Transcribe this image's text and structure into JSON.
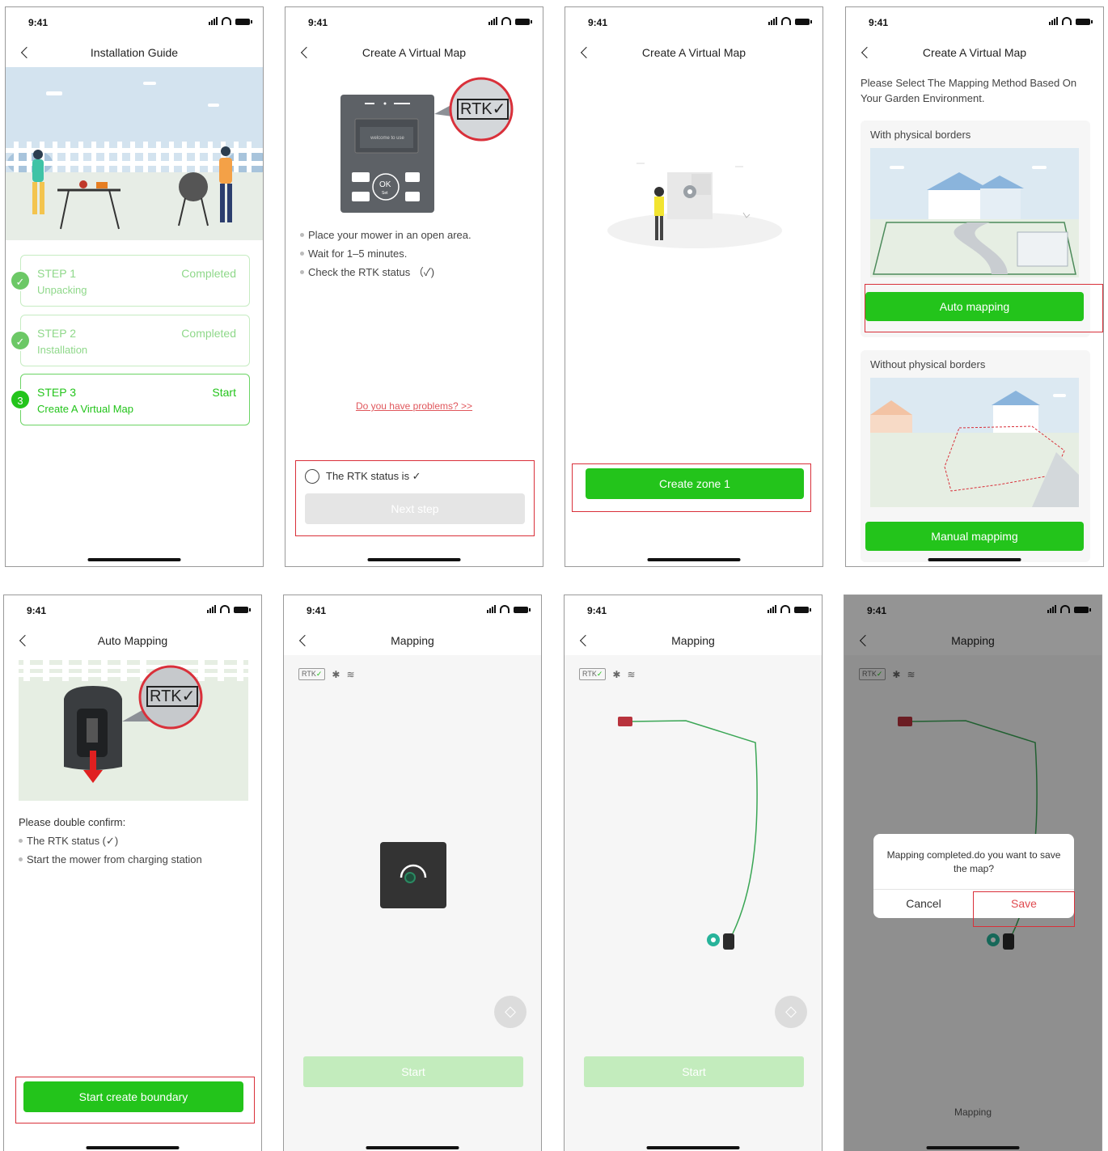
{
  "status": {
    "time": "9:41"
  },
  "screen1": {
    "title": "Installation Guide",
    "steps": [
      {
        "num": "",
        "name": "STEP 1",
        "desc": "Unpacking",
        "state": "Completed"
      },
      {
        "num": "",
        "name": "STEP 2",
        "desc": "Installation",
        "state": "Completed"
      },
      {
        "num": "3",
        "name": "STEP 3",
        "desc": "Create A Virtual Map",
        "state": "Start"
      }
    ]
  },
  "screen2": {
    "title": "Create A Virtual Map",
    "device": {
      "screen_text": "welcome to use",
      "ok_label": "OK",
      "set_label": "Set",
      "badge": "RTK✓"
    },
    "bullets": [
      "Place your mower in an open area.",
      "Wait for 1–5 minutes.",
      "Check the RTK status （✓)"
    ],
    "problem_link": "Do you have problems?  >>",
    "checkbox_label": "The RTK status is ✓",
    "next_button": "Next step"
  },
  "screen3": {
    "title": "Create A Virtual Map",
    "create_button": "Create zone 1"
  },
  "screen4": {
    "title": "Create A Virtual Map",
    "instruction": "Please Select The Mapping Method Based On Your Garden Environment.",
    "option1": {
      "caption": "With physical borders",
      "button": "Auto mapping"
    },
    "option2": {
      "caption": "Without physical borders",
      "button": "Manual mappimg"
    }
  },
  "screen5": {
    "title": "Auto Mapping",
    "badge": "RTK✓",
    "confirm_heading": "Please double confirm:",
    "bullets": [
      "The RTK status (✓)",
      "Start the mower from charging station"
    ],
    "start_button": "Start create boundary"
  },
  "screen6": {
    "title": "Mapping",
    "rtk_text": "RTK",
    "rtk_check": "✓",
    "start_button": "Start"
  },
  "screen7": {
    "title": "Mapping",
    "rtk_text": "RTK",
    "rtk_check": "✓",
    "start_button": "Start"
  },
  "screen8": {
    "title": "Mapping",
    "rtk_text": "RTK",
    "rtk_check": "✓",
    "dialog_message": "Mapping completed.do you want to save the map?",
    "cancel_button": "Cancel",
    "save_button": "Save",
    "footer_label": "Mapping"
  },
  "colors": {
    "brand_green": "#23c41b",
    "highlight_red": "#d9303a",
    "path_green": "#3aa655"
  }
}
